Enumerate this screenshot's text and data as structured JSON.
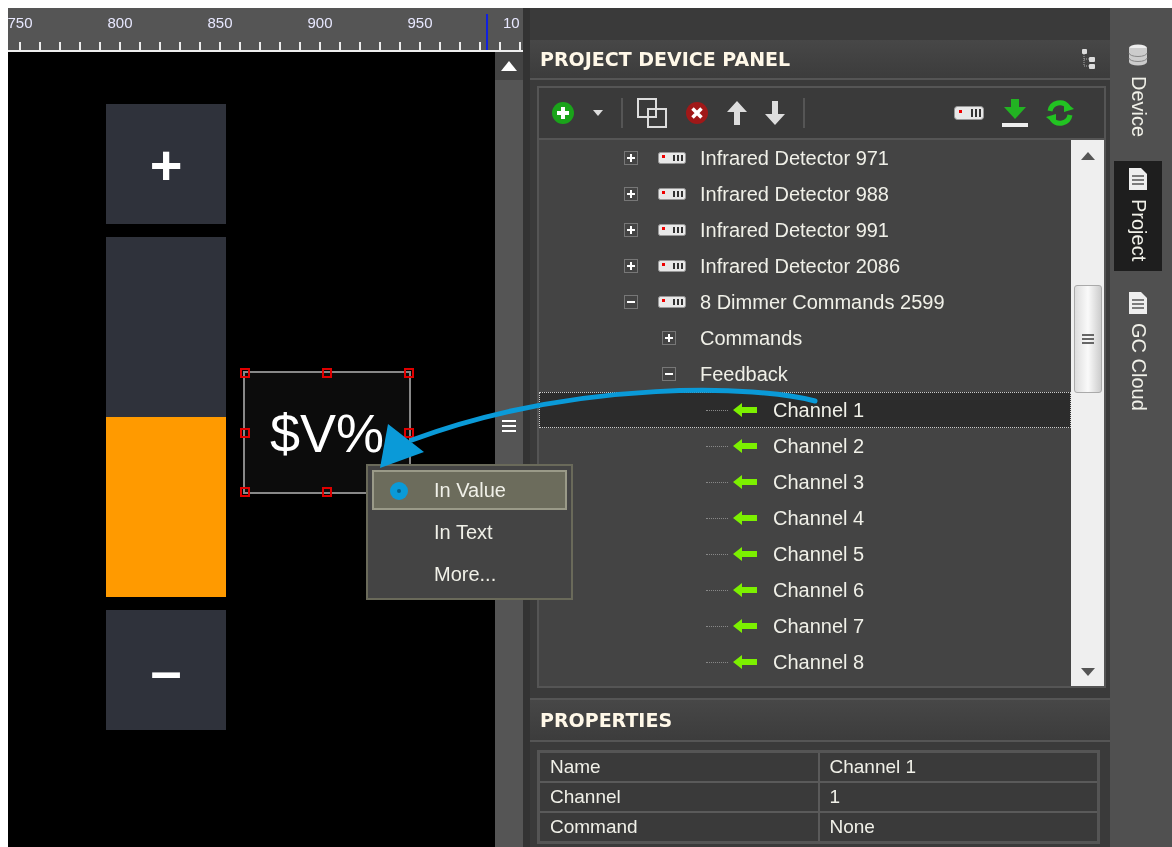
{
  "ruler": {
    "labels": [
      "750",
      "800",
      "850",
      "900",
      "950",
      "10"
    ]
  },
  "canvas": {
    "slider": {
      "plus": "+",
      "minus": "–",
      "level": 0.5
    },
    "label": {
      "text": "$V%",
      "selected": true
    },
    "context_menu": {
      "items": [
        {
          "label": "In Value",
          "selected": true
        },
        {
          "label": "In Text",
          "selected": false
        },
        {
          "label": "More...",
          "selected": false
        }
      ]
    }
  },
  "device_panel": {
    "title": "PROJECT DEVICE PANEL",
    "tree": [
      {
        "kind": "device",
        "label": "Infrared Detector 971",
        "expanded": false,
        "selected": false
      },
      {
        "kind": "device",
        "label": "Infrared Detector 988",
        "expanded": false,
        "selected": false
      },
      {
        "kind": "device",
        "label": "Infrared Detector 991",
        "expanded": false,
        "selected": false
      },
      {
        "kind": "device",
        "label": "Infrared Detector 2086",
        "expanded": false,
        "selected": false
      },
      {
        "kind": "device",
        "label": "8 Dimmer Commands 2599",
        "expanded": true,
        "selected": false,
        "children": [
          {
            "kind": "group",
            "label": "Commands",
            "expanded": false,
            "selected": false
          },
          {
            "kind": "group",
            "label": "Feedback",
            "expanded": true,
            "selected": false,
            "children": [
              {
                "kind": "channel",
                "label": "Channel 1",
                "selected": true
              },
              {
                "kind": "channel",
                "label": "Channel 2",
                "selected": false
              },
              {
                "kind": "channel",
                "label": "Channel 3",
                "selected": false
              },
              {
                "kind": "channel",
                "label": "Channel 4",
                "selected": false
              },
              {
                "kind": "channel",
                "label": "Channel 5",
                "selected": false
              },
              {
                "kind": "channel",
                "label": "Channel 6",
                "selected": false
              },
              {
                "kind": "channel",
                "label": "Channel 7",
                "selected": false
              },
              {
                "kind": "channel",
                "label": "Channel 8",
                "selected": false
              }
            ]
          }
        ]
      }
    ]
  },
  "properties": {
    "title": "PROPERTIES",
    "rows": [
      {
        "name": "Name",
        "value": "Channel 1"
      },
      {
        "name": "Channel",
        "value": "1"
      },
      {
        "name": "Command",
        "value": "None"
      }
    ]
  },
  "side_tabs": [
    {
      "label": "Device",
      "selected": false
    },
    {
      "label": "Project",
      "selected": true
    },
    {
      "label": "GC Cloud",
      "selected": false
    }
  ]
}
